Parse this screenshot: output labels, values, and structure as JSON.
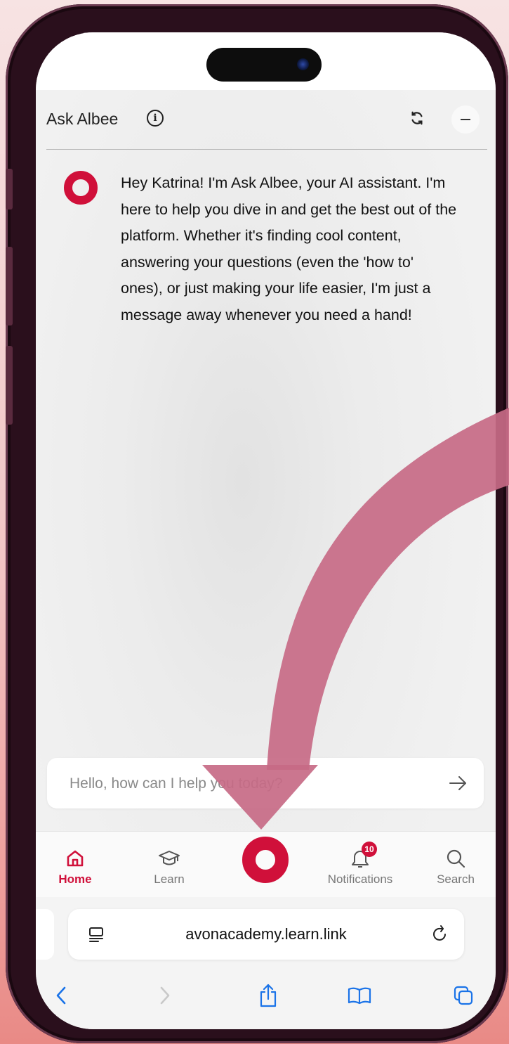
{
  "chat": {
    "title": "Ask Albee",
    "message": "Hey Katrina! I'm Ask Albee, your AI assistant. I'm here to help you dive in and get the best out of the platform. Whether it's finding cool content, answering your questions (even the 'how to' ones), or just making your life easier, I'm just a message away whenever you need a hand!",
    "input_placeholder": "Hello, how can I help you today?"
  },
  "tabbar": {
    "tabs": [
      {
        "label": "Home",
        "icon": "home-icon",
        "active": true
      },
      {
        "label": "Learn",
        "icon": "graduation-cap-icon",
        "active": false
      },
      {
        "label": "",
        "icon": "ask-albee-ring-icon",
        "active": false
      },
      {
        "label": "Notifications",
        "icon": "bell-icon",
        "active": false,
        "badge": "10"
      },
      {
        "label": "Search",
        "icon": "search-icon",
        "active": false
      }
    ]
  },
  "browser": {
    "url": "avonacademy.learn.link"
  },
  "colors": {
    "brand": "#d0103a",
    "arrow": "#c76a86",
    "ios_blue": "#1a73e8"
  }
}
